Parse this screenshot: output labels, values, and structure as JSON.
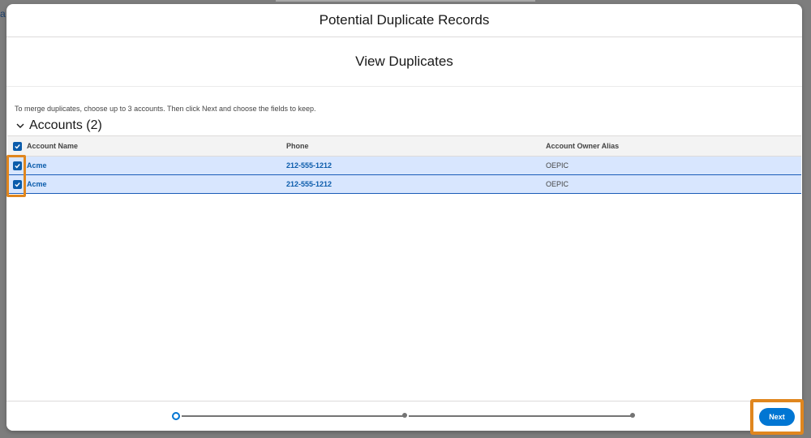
{
  "modal": {
    "title": "Potential Duplicate Records",
    "subtitle": "View Duplicates",
    "instruction": "To merge duplicates, choose up to 3 accounts. Then click Next and choose the fields to keep.",
    "section_label": "Accounts (2)"
  },
  "table": {
    "headers": [
      "Account Name",
      "Phone",
      "Account Owner Alias"
    ],
    "rows": [
      {
        "name": "Acme",
        "phone": "212-555-1212",
        "alias": "OEPIC",
        "checked": true
      },
      {
        "name": "Acme",
        "phone": "212-555-1212",
        "alias": "OEPIC",
        "checked": true
      }
    ]
  },
  "progress": {
    "steps": 3,
    "current": 1
  },
  "footer": {
    "next_label": "Next"
  },
  "colors": {
    "accent": "#0176d3",
    "highlight": "#e0861e",
    "row_selected": "#d8e6fe"
  },
  "icons": [
    "checkbox-checked-icon",
    "chevron-down-icon"
  ]
}
